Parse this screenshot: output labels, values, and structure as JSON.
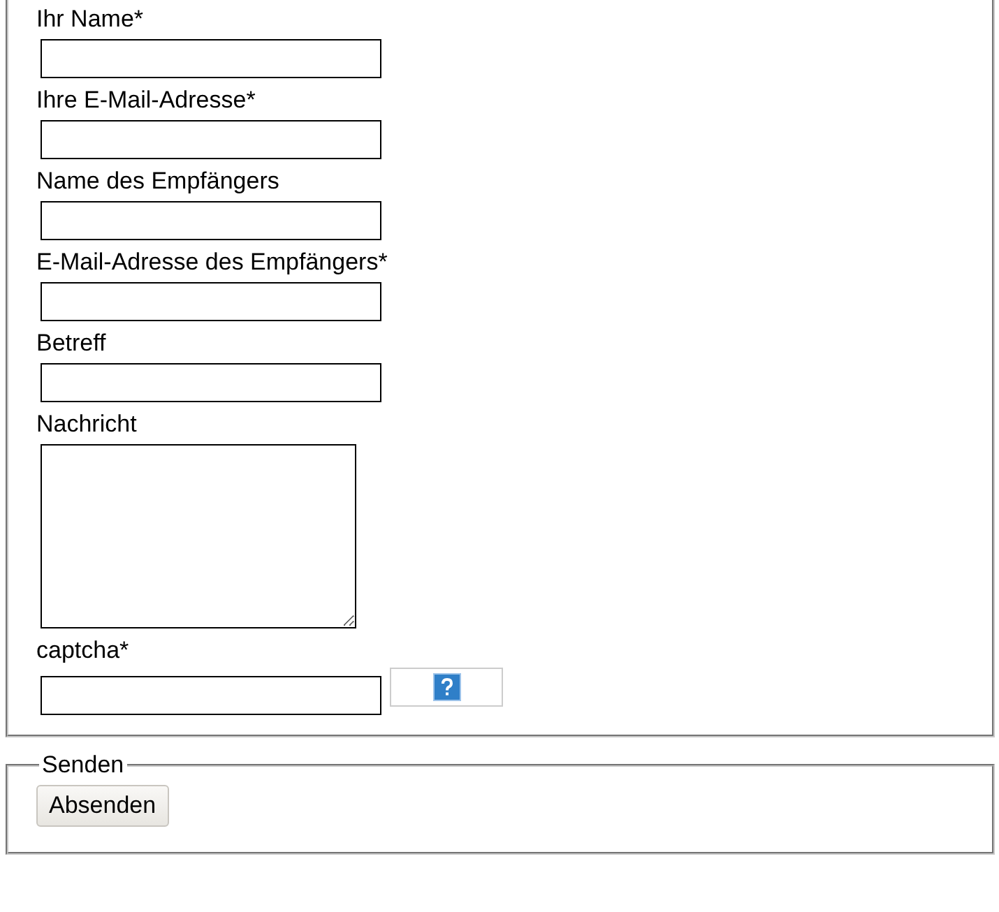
{
  "form": {
    "fields": [
      {
        "kind": "text",
        "label": "Ihr Name*"
      },
      {
        "kind": "text",
        "label": "Ihre E-Mail-Adresse*"
      },
      {
        "kind": "text",
        "label": "Name des Empfängers"
      },
      {
        "kind": "text",
        "label": "E-Mail-Adresse des Empfängers*"
      },
      {
        "kind": "text",
        "label": "Betreff"
      },
      {
        "kind": "textarea",
        "label": "Nachricht"
      },
      {
        "kind": "captcha",
        "label": "captcha*"
      }
    ]
  },
  "send_section": {
    "legend": "Senden",
    "button": "Absenden"
  }
}
